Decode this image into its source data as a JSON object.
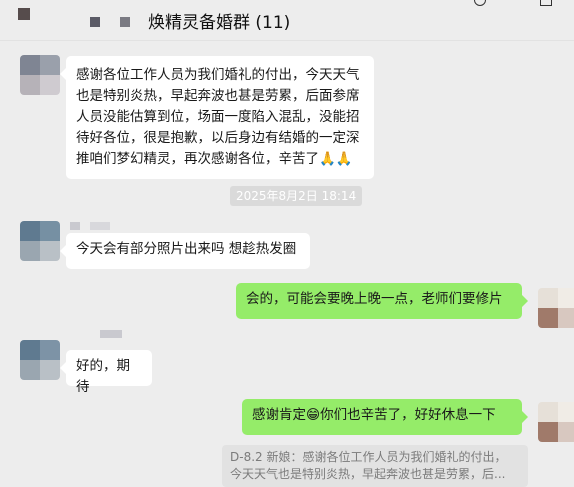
{
  "header": {
    "title": "焕精灵备婚群 (11)"
  },
  "messages": [
    {
      "dir": "in",
      "text": "感谢各位工作人员为我们婚礼的付出，今天天气也是特别炎热，早起奔波也甚是劳累，后面参席人员没能估算到位，场面一度陷入混乱，没能招待好各位，很是抱歉，以后身边有结婚的一定深推咱们梦幻精灵，再次感谢各位，辛苦了",
      "emoji": "🙏🙏"
    },
    {
      "dir": "in",
      "text": "今天会有部分照片出来吗 想趁热发圈"
    },
    {
      "dir": "out",
      "text": "会的，可能会要晚上晚一点，老师们要修片"
    },
    {
      "dir": "in",
      "text": "好的，期待"
    },
    {
      "dir": "out",
      "text_before": "感谢肯定",
      "emoji": "😁",
      "text_after": "你们也辛苦了，好好休息一下"
    }
  ],
  "timestamp": "2025年8月2日 18:14",
  "quote": {
    "line1": "D-8.2 新娘：感谢各位工作人员为我们婚礼的付出，",
    "line2": "今天天气也是特别炎热，早起奔波也甚是劳累，后..."
  },
  "colors": {
    "bg": "#ededed",
    "out_bubble": "#95ec69",
    "in_bubble": "#ffffff"
  }
}
